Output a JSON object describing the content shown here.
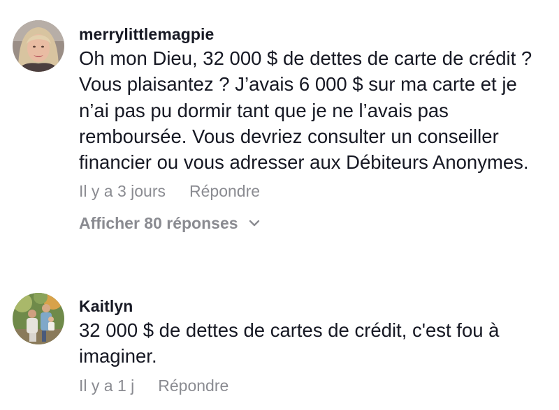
{
  "comments": [
    {
      "username": "merrylittlemagpie",
      "text": "Oh mon Dieu, 32 000 $ de dettes de carte de crédit ? Vous plaisantez ? J’avais 6 000 $ sur ma carte et je n’ai pas pu dormir tant que je ne l’avais pas remboursée. Vous devriez consulter un conseiller financier ou vous adresser aux Débiteurs Anonymes.",
      "time": "Il y a 3 jours",
      "reply_label": "Répondre",
      "view_replies": "Afficher 80 réponses"
    },
    {
      "username": "Kaitlyn",
      "text": "32 000 $ de dettes de cartes de crédit, c'est fou à imaginer.",
      "time": "Il y a 1 j",
      "reply_label": "Répondre"
    }
  ],
  "colors": {
    "text": "#161823",
    "secondary": "#8a8b91"
  }
}
